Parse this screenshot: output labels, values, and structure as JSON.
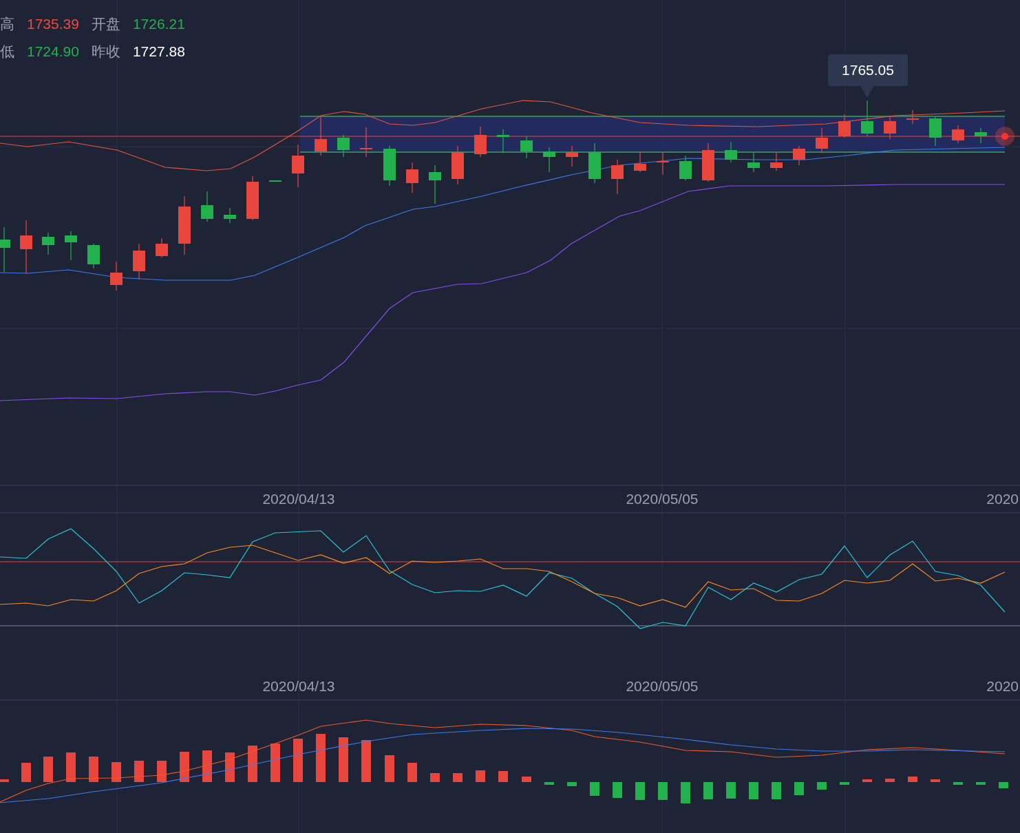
{
  "quote": [
    {
      "label": "高",
      "value": "1735.39",
      "color": "#f0483e"
    },
    {
      "label": "开盘",
      "value": "1726.21",
      "color": "#22b14c"
    },
    {
      "label": "低",
      "value": "1724.90",
      "color": "#22b14c"
    },
    {
      "label": "昨收",
      "value": "1727.88",
      "color": "#ffffff"
    }
  ],
  "price_chart": {
    "tooltip": "1765.05",
    "x_labels": [
      "2020/04/13",
      "2020/05/05",
      "2020"
    ]
  },
  "rsi_chart": {
    "x_labels": [
      "2020/04/13",
      "2020/05/05",
      "2020"
    ]
  }
}
